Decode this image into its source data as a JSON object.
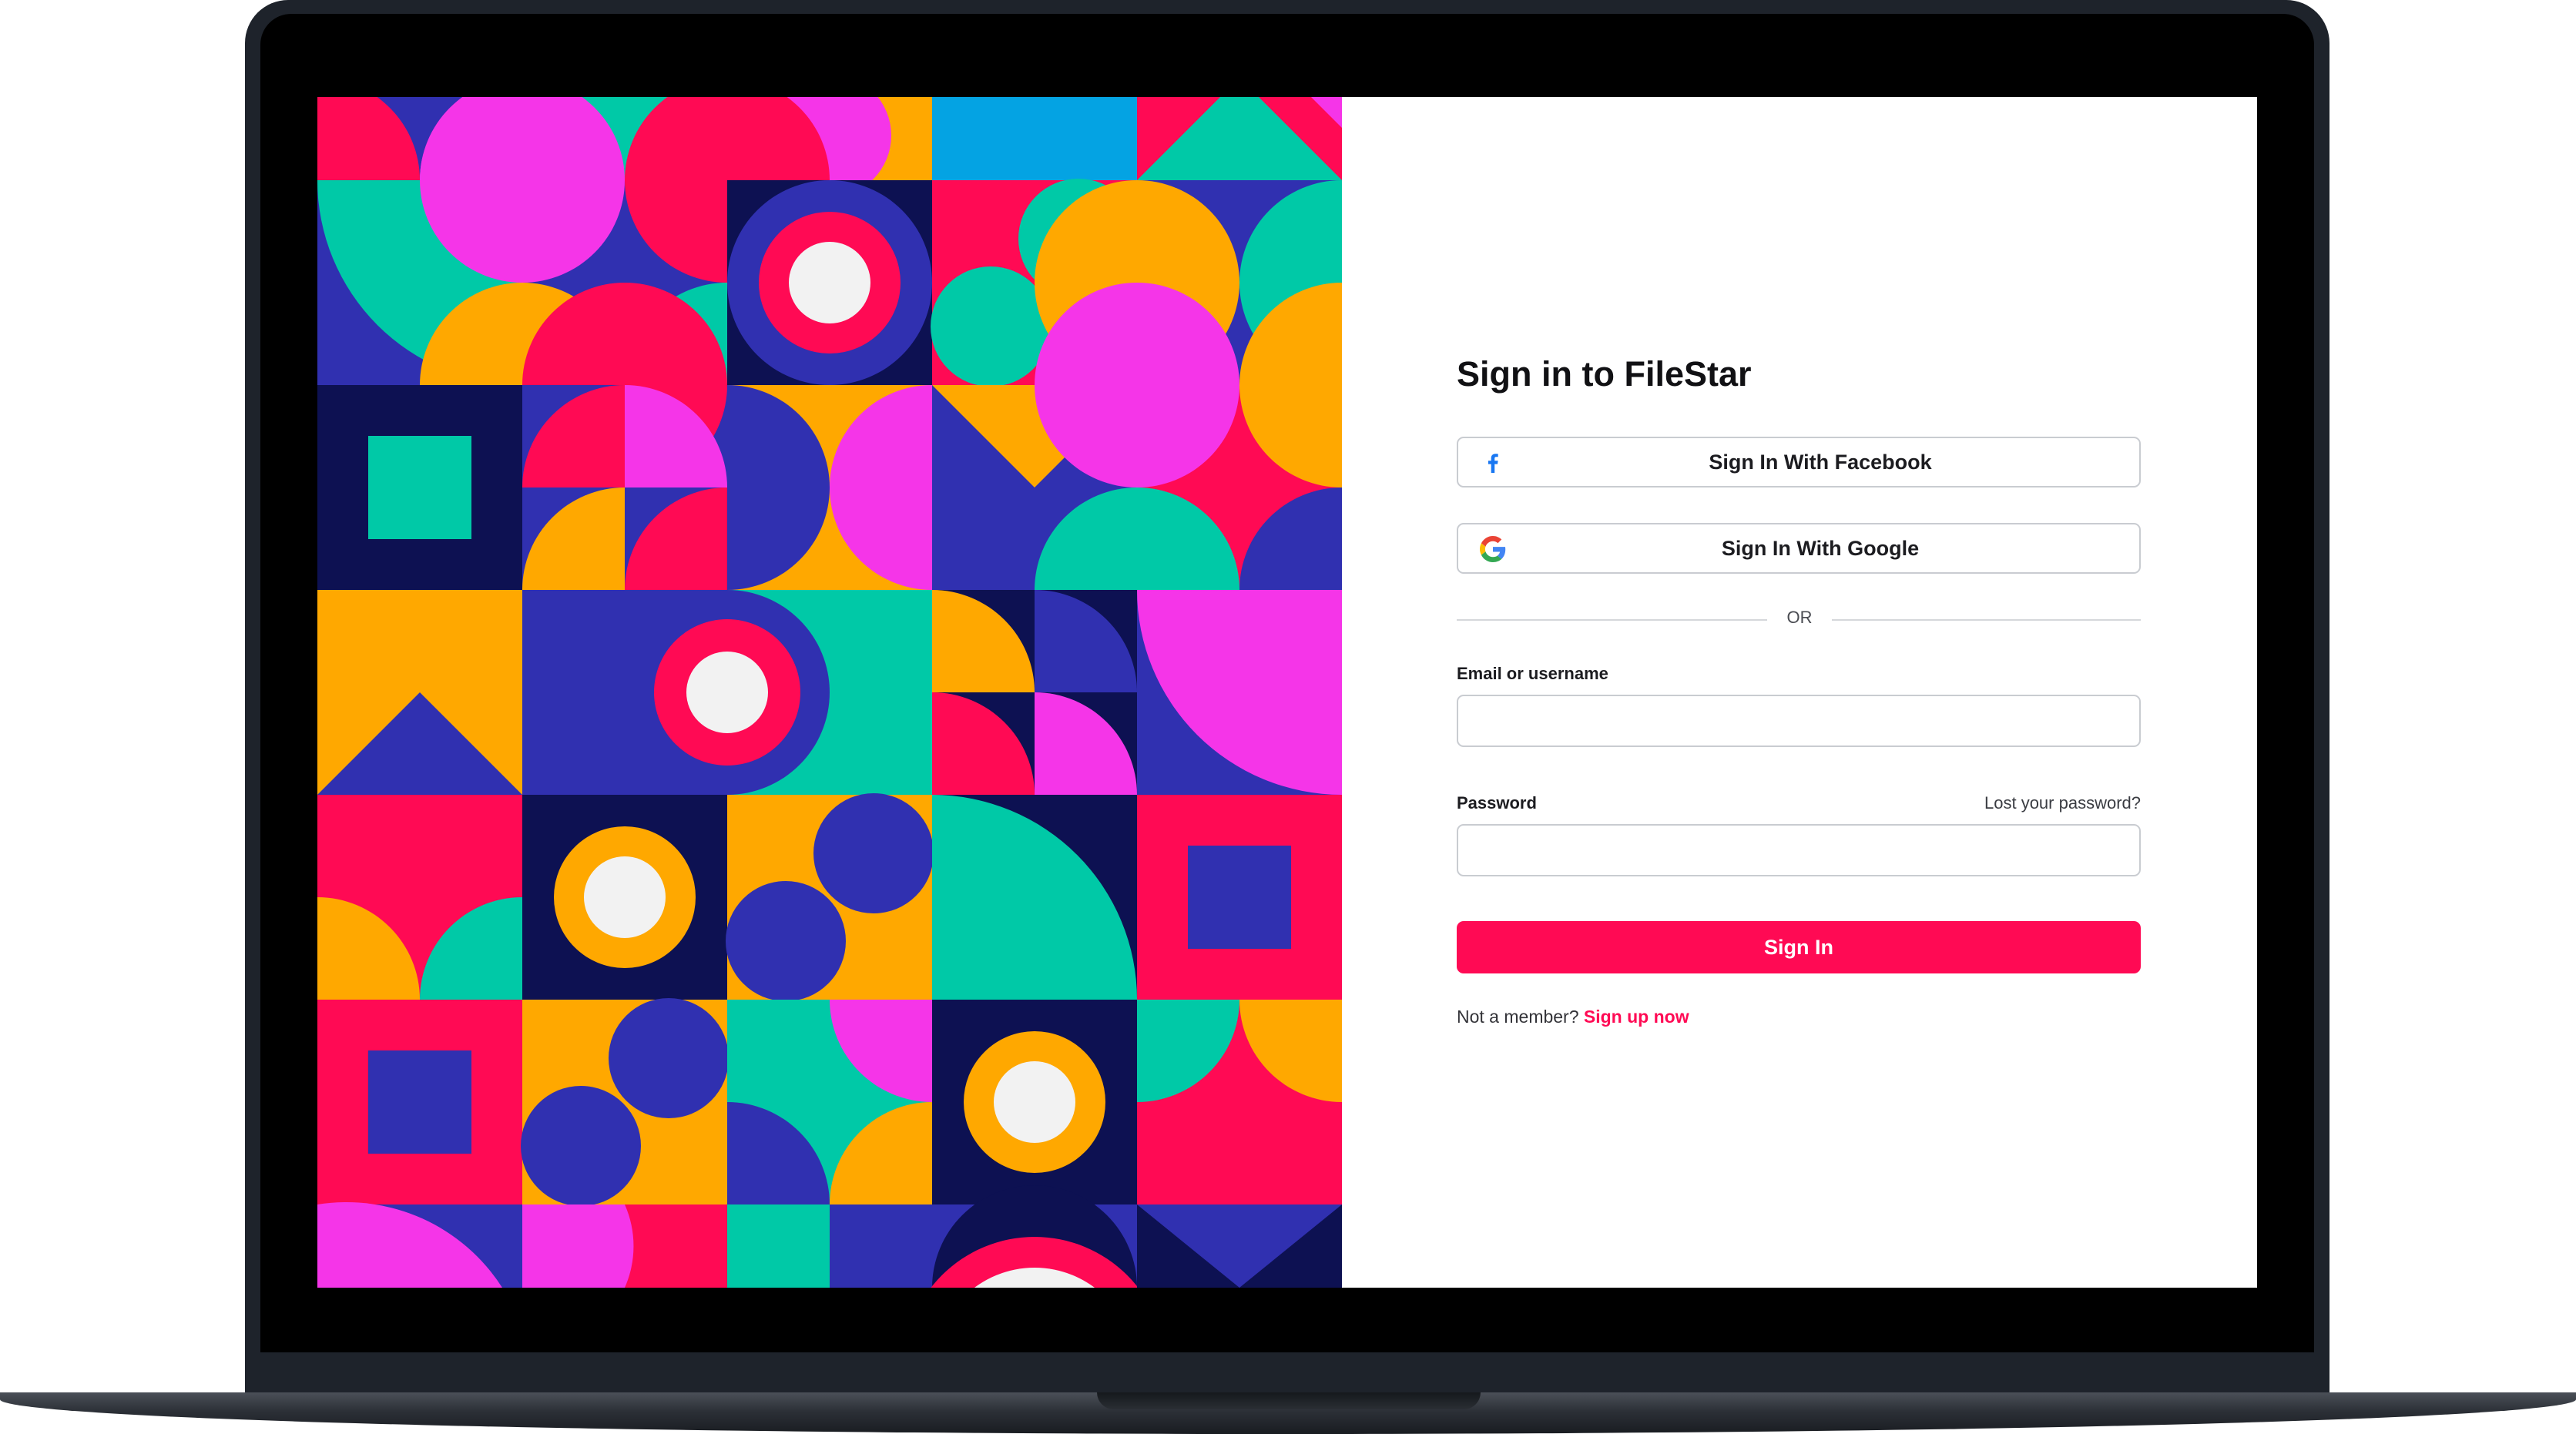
{
  "login": {
    "title": "Sign in to FileStar",
    "facebook_button": "Sign In With Facebook",
    "google_button": "Sign In With Google",
    "divider_text": "OR",
    "email_label": "Email or username",
    "email_value": "",
    "password_label": "Password",
    "password_value": "",
    "lost_password_link": "Lost your password?",
    "sign_in_button": "Sign In",
    "not_member_text": "Not a member?",
    "sign_up_link": "Sign up now"
  },
  "icons": {
    "facebook": "facebook-icon",
    "google": "google-icon"
  },
  "colors": {
    "accent": "#ff0a54",
    "facebook_blue": "#1877f2",
    "art_palette": [
      "#f535e8",
      "#00c9a7",
      "#ffa800",
      "#3030b0",
      "#ff0a54",
      "#0d1152",
      "#04a3e3",
      "#f2f2f2"
    ]
  }
}
